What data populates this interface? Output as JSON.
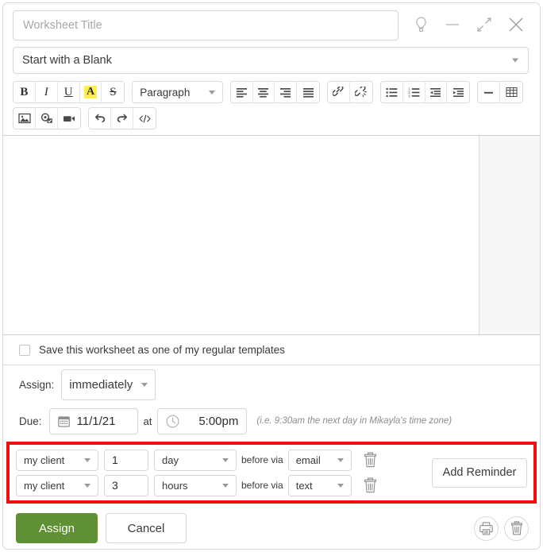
{
  "window": {
    "controls": [
      {
        "name": "lightbulb-icon",
        "label": "Tips"
      },
      {
        "name": "minimize-icon",
        "label": "Minimize"
      },
      {
        "name": "collapse-icon",
        "label": "Collapse"
      },
      {
        "name": "close-icon",
        "label": "Close"
      }
    ]
  },
  "header": {
    "title_value": "",
    "title_placeholder": "Worksheet Title",
    "template_selected": "Start with a Blank"
  },
  "toolbar": {
    "row1": {
      "bold": "B",
      "italic": "I",
      "underline": "U",
      "highlight": "A",
      "strikethrough": "S",
      "paragraph_style": "Paragraph"
    }
  },
  "editor": {
    "content": ""
  },
  "options": {
    "save_template_label": "Save this worksheet as one of my regular templates",
    "save_template_checked": false
  },
  "assign": {
    "label": "Assign:",
    "value": "immediately"
  },
  "due": {
    "label": "Due:",
    "date_value": "11/1/21",
    "at_label": "at",
    "time_value": "5:00pm",
    "hint": "(i.e. 9:30am the next day in Mikayla's time zone)"
  },
  "reminders": {
    "highlight_color": "#ef0f0f",
    "before_via_label": "before via",
    "add_button_label": "Add Reminder",
    "rows": [
      {
        "who": "my client",
        "amount": "1",
        "unit": "day",
        "via": "email"
      },
      {
        "who": "my client",
        "amount": "3",
        "unit": "hours",
        "via": "text"
      }
    ]
  },
  "footer": {
    "assign_label": "Assign",
    "assign_color": "#5f9134",
    "cancel_label": "Cancel",
    "print_icon": "printer-icon",
    "delete_icon": "trash-icon"
  }
}
